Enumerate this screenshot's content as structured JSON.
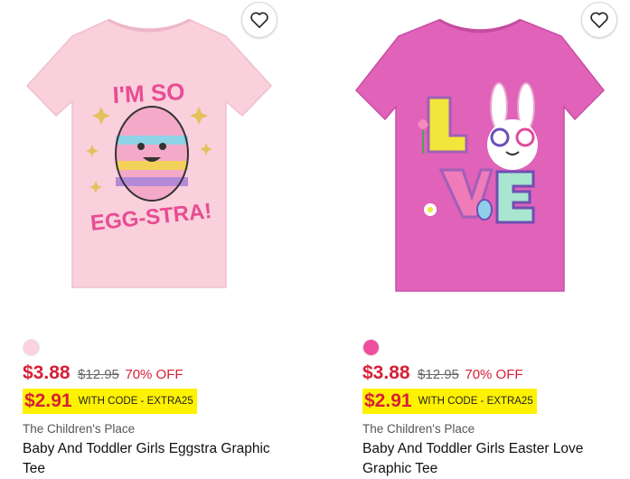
{
  "products": [
    {
      "swatch_color": "#fbd3df",
      "sale_price": "$3.88",
      "original_price": "$12.95",
      "discount": "70% OFF",
      "promo_price": "$2.91",
      "promo_text": "WITH CODE - EXTRA25",
      "brand": "The Children's Place",
      "title": "Baby And Toddler Girls Eggstra Graphic Tee",
      "shirt_color": "#f9d0dc",
      "graphic_top": "I'M SO",
      "graphic_bottom": "EGG-STRA!"
    },
    {
      "swatch_color": "#ef4f9e",
      "sale_price": "$3.88",
      "original_price": "$12.95",
      "discount": "70% OFF",
      "promo_price": "$2.91",
      "promo_text": "WITH CODE - EXTRA25",
      "brand": "The Children's Place",
      "title": "Baby And Toddler Girls Easter Love Graphic Tee",
      "shirt_color": "#e062b9",
      "graphic_top": "LO",
      "graphic_bottom": "VE"
    }
  ],
  "icons": {
    "favorite": "heart-outline-icon"
  }
}
